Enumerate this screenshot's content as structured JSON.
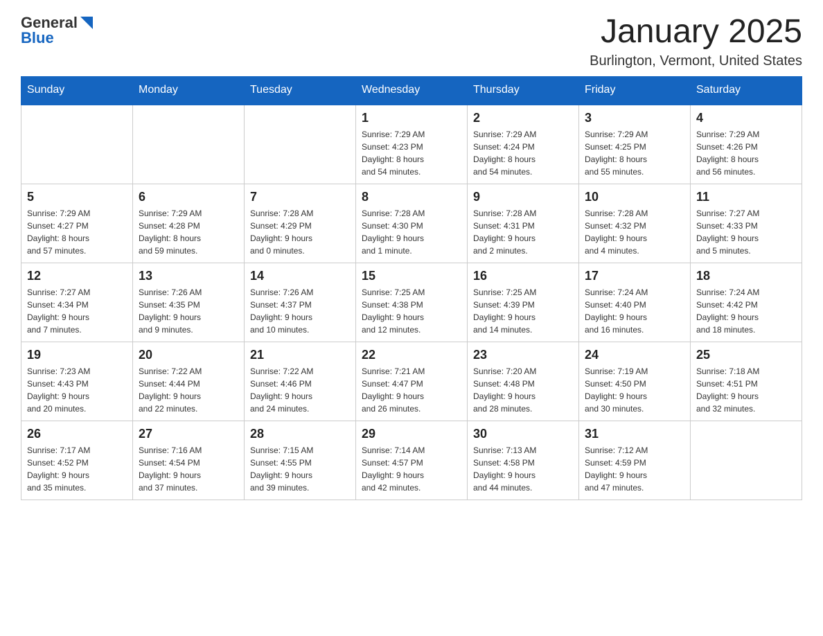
{
  "header": {
    "logo": {
      "general": "General",
      "blue": "Blue"
    },
    "title": "January 2025",
    "location": "Burlington, Vermont, United States"
  },
  "weekdays": [
    "Sunday",
    "Monday",
    "Tuesday",
    "Wednesday",
    "Thursday",
    "Friday",
    "Saturday"
  ],
  "weeks": [
    [
      {
        "day": "",
        "info": ""
      },
      {
        "day": "",
        "info": ""
      },
      {
        "day": "",
        "info": ""
      },
      {
        "day": "1",
        "info": "Sunrise: 7:29 AM\nSunset: 4:23 PM\nDaylight: 8 hours\nand 54 minutes."
      },
      {
        "day": "2",
        "info": "Sunrise: 7:29 AM\nSunset: 4:24 PM\nDaylight: 8 hours\nand 54 minutes."
      },
      {
        "day": "3",
        "info": "Sunrise: 7:29 AM\nSunset: 4:25 PM\nDaylight: 8 hours\nand 55 minutes."
      },
      {
        "day": "4",
        "info": "Sunrise: 7:29 AM\nSunset: 4:26 PM\nDaylight: 8 hours\nand 56 minutes."
      }
    ],
    [
      {
        "day": "5",
        "info": "Sunrise: 7:29 AM\nSunset: 4:27 PM\nDaylight: 8 hours\nand 57 minutes."
      },
      {
        "day": "6",
        "info": "Sunrise: 7:29 AM\nSunset: 4:28 PM\nDaylight: 8 hours\nand 59 minutes."
      },
      {
        "day": "7",
        "info": "Sunrise: 7:28 AM\nSunset: 4:29 PM\nDaylight: 9 hours\nand 0 minutes."
      },
      {
        "day": "8",
        "info": "Sunrise: 7:28 AM\nSunset: 4:30 PM\nDaylight: 9 hours\nand 1 minute."
      },
      {
        "day": "9",
        "info": "Sunrise: 7:28 AM\nSunset: 4:31 PM\nDaylight: 9 hours\nand 2 minutes."
      },
      {
        "day": "10",
        "info": "Sunrise: 7:28 AM\nSunset: 4:32 PM\nDaylight: 9 hours\nand 4 minutes."
      },
      {
        "day": "11",
        "info": "Sunrise: 7:27 AM\nSunset: 4:33 PM\nDaylight: 9 hours\nand 5 minutes."
      }
    ],
    [
      {
        "day": "12",
        "info": "Sunrise: 7:27 AM\nSunset: 4:34 PM\nDaylight: 9 hours\nand 7 minutes."
      },
      {
        "day": "13",
        "info": "Sunrise: 7:26 AM\nSunset: 4:35 PM\nDaylight: 9 hours\nand 9 minutes."
      },
      {
        "day": "14",
        "info": "Sunrise: 7:26 AM\nSunset: 4:37 PM\nDaylight: 9 hours\nand 10 minutes."
      },
      {
        "day": "15",
        "info": "Sunrise: 7:25 AM\nSunset: 4:38 PM\nDaylight: 9 hours\nand 12 minutes."
      },
      {
        "day": "16",
        "info": "Sunrise: 7:25 AM\nSunset: 4:39 PM\nDaylight: 9 hours\nand 14 minutes."
      },
      {
        "day": "17",
        "info": "Sunrise: 7:24 AM\nSunset: 4:40 PM\nDaylight: 9 hours\nand 16 minutes."
      },
      {
        "day": "18",
        "info": "Sunrise: 7:24 AM\nSunset: 4:42 PM\nDaylight: 9 hours\nand 18 minutes."
      }
    ],
    [
      {
        "day": "19",
        "info": "Sunrise: 7:23 AM\nSunset: 4:43 PM\nDaylight: 9 hours\nand 20 minutes."
      },
      {
        "day": "20",
        "info": "Sunrise: 7:22 AM\nSunset: 4:44 PM\nDaylight: 9 hours\nand 22 minutes."
      },
      {
        "day": "21",
        "info": "Sunrise: 7:22 AM\nSunset: 4:46 PM\nDaylight: 9 hours\nand 24 minutes."
      },
      {
        "day": "22",
        "info": "Sunrise: 7:21 AM\nSunset: 4:47 PM\nDaylight: 9 hours\nand 26 minutes."
      },
      {
        "day": "23",
        "info": "Sunrise: 7:20 AM\nSunset: 4:48 PM\nDaylight: 9 hours\nand 28 minutes."
      },
      {
        "day": "24",
        "info": "Sunrise: 7:19 AM\nSunset: 4:50 PM\nDaylight: 9 hours\nand 30 minutes."
      },
      {
        "day": "25",
        "info": "Sunrise: 7:18 AM\nSunset: 4:51 PM\nDaylight: 9 hours\nand 32 minutes."
      }
    ],
    [
      {
        "day": "26",
        "info": "Sunrise: 7:17 AM\nSunset: 4:52 PM\nDaylight: 9 hours\nand 35 minutes."
      },
      {
        "day": "27",
        "info": "Sunrise: 7:16 AM\nSunset: 4:54 PM\nDaylight: 9 hours\nand 37 minutes."
      },
      {
        "day": "28",
        "info": "Sunrise: 7:15 AM\nSunset: 4:55 PM\nDaylight: 9 hours\nand 39 minutes."
      },
      {
        "day": "29",
        "info": "Sunrise: 7:14 AM\nSunset: 4:57 PM\nDaylight: 9 hours\nand 42 minutes."
      },
      {
        "day": "30",
        "info": "Sunrise: 7:13 AM\nSunset: 4:58 PM\nDaylight: 9 hours\nand 44 minutes."
      },
      {
        "day": "31",
        "info": "Sunrise: 7:12 AM\nSunset: 4:59 PM\nDaylight: 9 hours\nand 47 minutes."
      },
      {
        "day": "",
        "info": ""
      }
    ]
  ]
}
